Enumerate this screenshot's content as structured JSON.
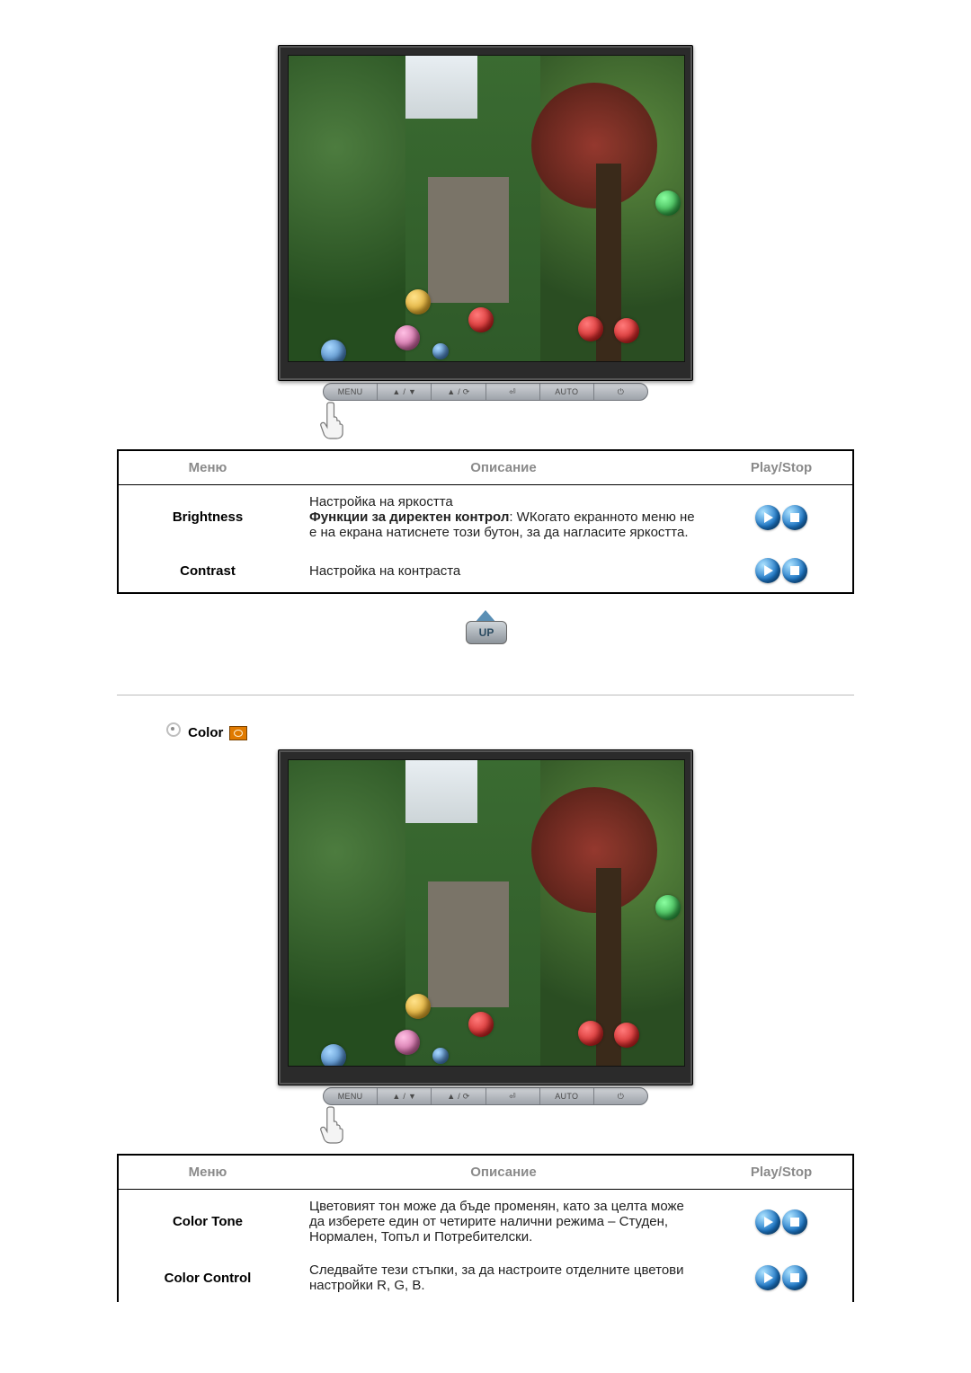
{
  "monitor_buttons": [
    "MENU",
    "▲ / ▼",
    "▲ / ⟳",
    "⏎",
    "AUTO",
    "⏻"
  ],
  "table1": {
    "headers": [
      "Меню",
      "Описание",
      "Play/Stop"
    ],
    "rows": [
      {
        "menu": "Brightness",
        "desc_line1": "Настройка на яркостта",
        "desc_bold": "Функции за директен контрол",
        "desc_after": ": WКогато екранното меню не е на екрана натиснете този бутон, за да нагласите яркостта."
      },
      {
        "menu": "Contrast",
        "desc_line1": "Настройка на контраста",
        "desc_bold": "",
        "desc_after": ""
      }
    ]
  },
  "up_label": "UP",
  "section2_title": "Color",
  "table2": {
    "headers": [
      "Меню",
      "Описание",
      "Play/Stop"
    ],
    "rows": [
      {
        "menu": "Color Tone",
        "desc": "Цветовият тон може да бъде променян, като за целта може да изберете един от четирите налични режима – Студен, Нормален, Топъл и Потребителски."
      },
      {
        "menu": "Color Control",
        "desc": "Следвайте тези стъпки, за да настроите отделните цветови настройки R, G, B."
      }
    ]
  }
}
